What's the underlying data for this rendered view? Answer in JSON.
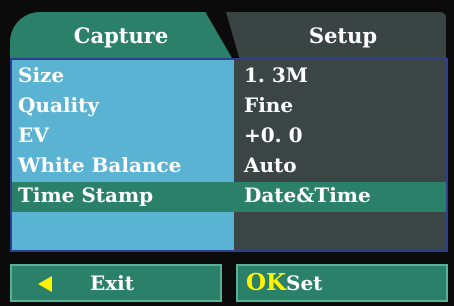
{
  "tabs": [
    {
      "label": "Capture",
      "active": true
    },
    {
      "label": "Setup",
      "active": false
    }
  ],
  "menu": {
    "items": [
      {
        "label": "Size",
        "value": "1. 3M"
      },
      {
        "label": "Quality",
        "value": "Fine"
      },
      {
        "label": "EV",
        "value": "+0. 0"
      },
      {
        "label": "White Balance",
        "value": "Auto"
      },
      {
        "label": "Time Stamp",
        "value": "Date&Time",
        "selected": true
      }
    ]
  },
  "footer": {
    "exit_label": "Exit",
    "ok_key": "OK",
    "ok_label": "Set"
  },
  "colors": {
    "active_tab": "#2a8068",
    "inactive_tab": "#3a4442",
    "label_column": "#5bb3d3",
    "value_column": "#3c4546",
    "highlight_row": "#2a8068",
    "accent_yellow": "#fff200",
    "panel_border": "#2e3f8e"
  }
}
